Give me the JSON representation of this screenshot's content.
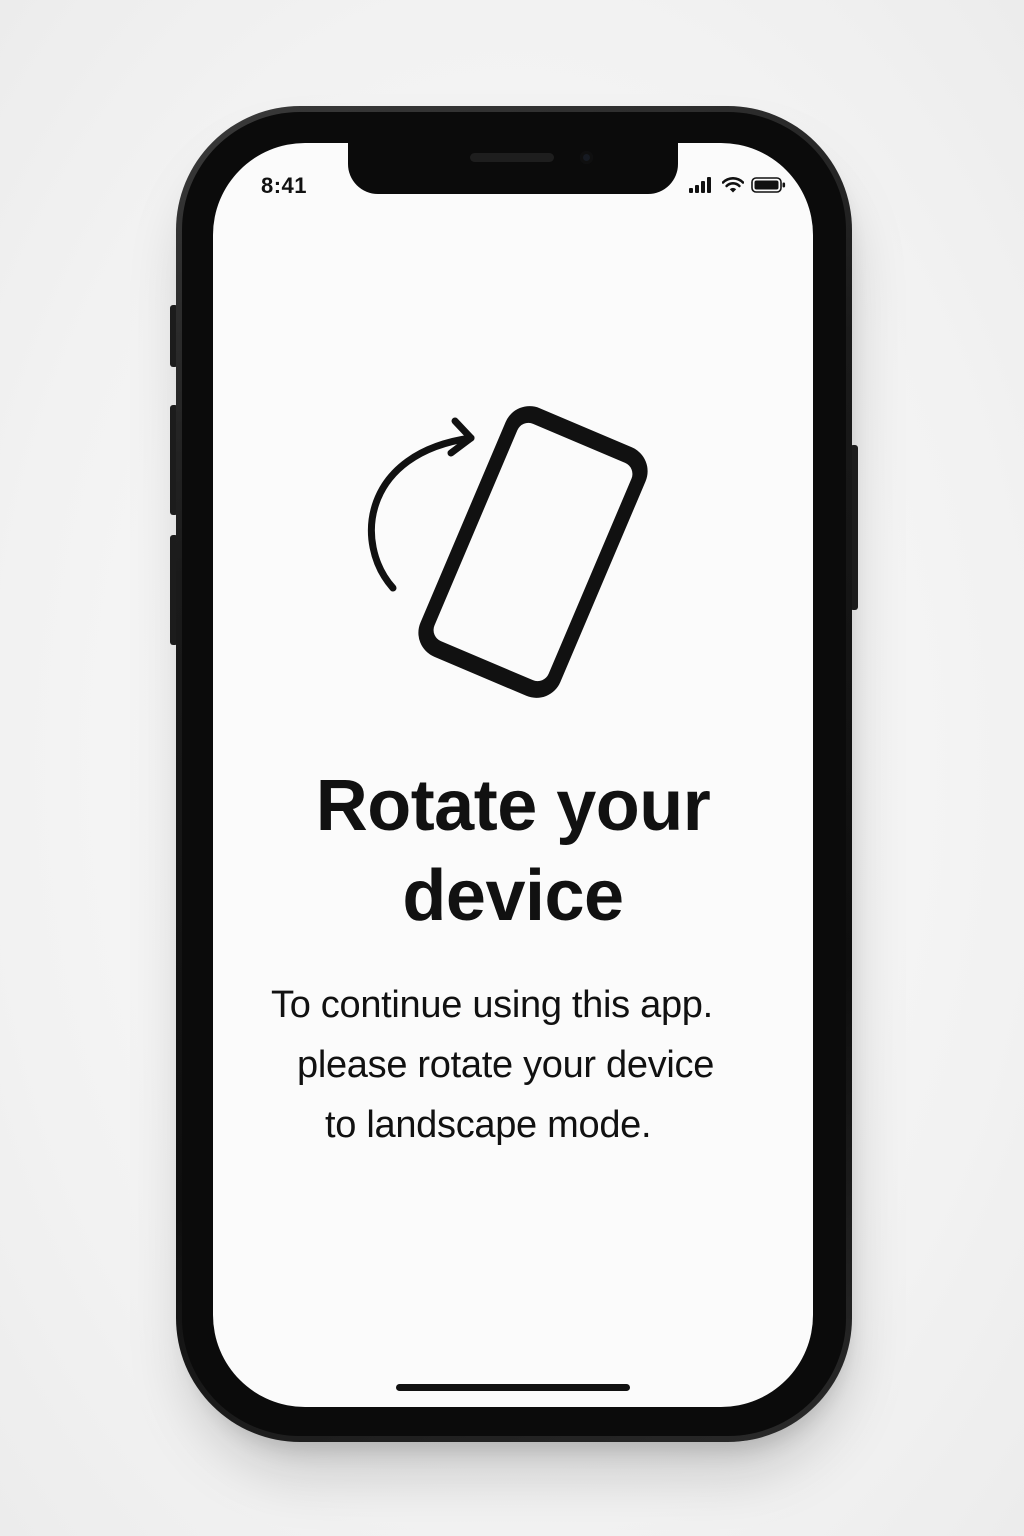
{
  "status_bar": {
    "time": "8:41",
    "icons": [
      "cellular-signal-icon",
      "wifi-icon",
      "battery-icon"
    ]
  },
  "illustration": {
    "icons": [
      "rotate-arrow-icon",
      "phone-icon"
    ]
  },
  "prompt": {
    "title_lines": [
      "Rotate your",
      "device"
    ],
    "message_lines": [
      "To continue using this app.",
      "please rotate your device",
      "to landscape mode."
    ]
  },
  "colors": {
    "text": "#111111",
    "screen_background": "#fbfbfb",
    "device_frame": "#0b0b0b"
  }
}
